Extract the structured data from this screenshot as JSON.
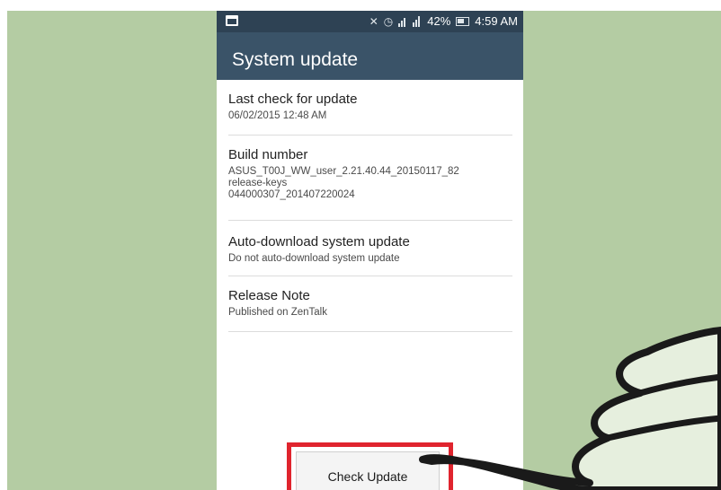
{
  "status_bar": {
    "battery": "42%",
    "time": "4:59 AM",
    "icons": [
      "notification-icon",
      "mute-icon",
      "alarm-icon",
      "signal-icon",
      "battery-charging-icon"
    ]
  },
  "app_bar": {
    "title": "System update"
  },
  "items": [
    {
      "title": "Last check for update",
      "lines": [
        "06/02/2015 12:48 AM"
      ]
    },
    {
      "title": "Build number",
      "lines": [
        "ASUS_T00J_WW_user_2.21.40.44_20150117_82",
        "release-keys",
        "044000307_201407220024"
      ]
    },
    {
      "title": "Auto-download system update",
      "lines": [
        "Do not auto-download system update"
      ]
    },
    {
      "title": "Release Note",
      "lines": [
        "Published on ZenTalk"
      ]
    }
  ],
  "button": {
    "label": "Check Update"
  },
  "colors": {
    "background": "#b4cca3",
    "status_bar": "#2e4254",
    "app_bar": "#3a5368",
    "highlight": "#e0242e"
  }
}
